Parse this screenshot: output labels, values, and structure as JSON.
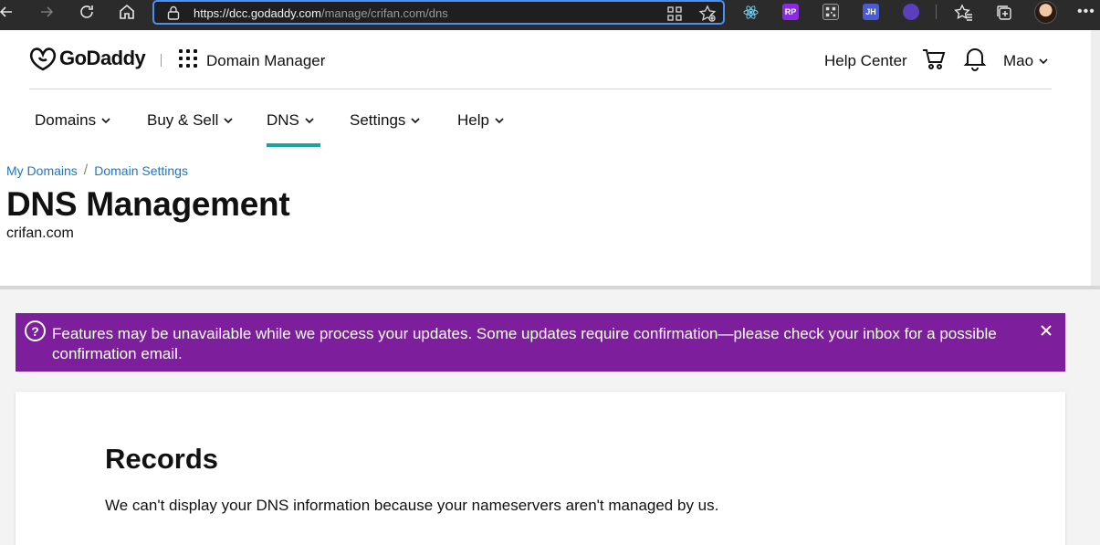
{
  "browser": {
    "url_host": "https://dcc.godaddy.com",
    "url_path": "/manage/crifan.com/dns",
    "extensions": [
      {
        "name": "react-devtools-icon",
        "color": "#2b2b2b",
        "label": ""
      },
      {
        "name": "rp-extension-icon",
        "color": "#8a2be2",
        "label": "RP"
      },
      {
        "name": "qr-extension-icon",
        "color": "#3a3a3a",
        "label": ""
      },
      {
        "name": "jh-extension-icon",
        "color": "#4a5bd6",
        "label": "JH"
      },
      {
        "name": "purple-extension-icon",
        "color": "#5b3fbf",
        "label": ""
      }
    ]
  },
  "header": {
    "brand": "GoDaddy",
    "product": "Domain Manager",
    "help_center": "Help Center",
    "user": "Mao"
  },
  "nav": {
    "items": [
      {
        "label": "Domains"
      },
      {
        "label": "Buy & Sell"
      },
      {
        "label": "DNS"
      },
      {
        "label": "Settings"
      },
      {
        "label": "Help"
      }
    ],
    "active": "DNS",
    "accent_color": "#1ba2a2"
  },
  "breadcrumb": {
    "items": [
      "My Domains",
      "Domain Settings"
    ],
    "separator": "/"
  },
  "page": {
    "title": "DNS Management",
    "domain": "crifan.com"
  },
  "banner": {
    "message": "Features may be unavailable while we process your updates. Some updates require confirmation—please check your inbox for a possible confirmation email.",
    "color": "#7d1e9c",
    "icon": "question-circle-icon"
  },
  "records": {
    "title": "Records",
    "message": "We can't display your DNS information because your nameservers aren't managed by us."
  }
}
